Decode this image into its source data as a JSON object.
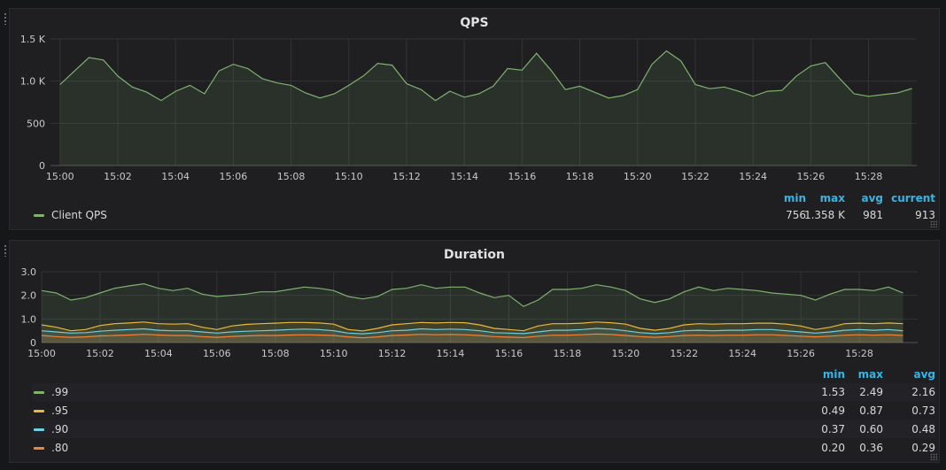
{
  "qps": {
    "title": "QPS",
    "y_ticks": [
      "0",
      "500",
      "1.0 K",
      "1.5 K"
    ],
    "x_ticks": [
      "15:00",
      "15:02",
      "15:04",
      "15:06",
      "15:08",
      "15:10",
      "15:12",
      "15:14",
      "15:16",
      "15:18",
      "15:20",
      "15:22",
      "15:24",
      "15:26",
      "15:28"
    ],
    "legend_headers": [
      "min",
      "max",
      "avg",
      "current"
    ],
    "legend": [
      {
        "name": "Client QPS",
        "color": "#7eb26d",
        "min": "756",
        "max": "1.358 K",
        "avg": "981",
        "current": "913"
      }
    ]
  },
  "duration": {
    "title": "Duration",
    "y_ticks": [
      "0",
      "1.0",
      "2.0",
      "3.0"
    ],
    "x_ticks": [
      "15:00",
      "15:02",
      "15:04",
      "15:06",
      "15:08",
      "15:10",
      "15:12",
      "15:14",
      "15:16",
      "15:18",
      "15:20",
      "15:22",
      "15:24",
      "15:26",
      "15:28"
    ],
    "legend_headers": [
      "min",
      "max",
      "avg"
    ],
    "legend": [
      {
        "name": ".99",
        "color": "#7eb26d",
        "min": "1.53",
        "max": "2.49",
        "avg": "2.16"
      },
      {
        "name": ".95",
        "color": "#eab839",
        "min": "0.49",
        "max": "0.87",
        "avg": "0.73"
      },
      {
        "name": ".90",
        "color": "#6ed0e0",
        "min": "0.37",
        "max": "0.60",
        "avg": "0.48"
      },
      {
        "name": ".80",
        "color": "#ef843c",
        "min": "0.20",
        "max": "0.36",
        "avg": "0.29"
      }
    ]
  },
  "chart_data": [
    {
      "type": "area",
      "title": "QPS",
      "ylim": [
        0,
        1500
      ],
      "xlim": [
        "14:59:40",
        "15:29:40"
      ],
      "grid": true,
      "legend_position": "bottom",
      "x_minutes": [
        0,
        0.5,
        1,
        1.5,
        2,
        2.5,
        3,
        3.5,
        4,
        4.5,
        5,
        5.5,
        6,
        6.5,
        7,
        7.5,
        8,
        8.5,
        9,
        9.5,
        10,
        10.5,
        11,
        11.5,
        12,
        12.5,
        13,
        13.5,
        14,
        14.5,
        15,
        15.5,
        16,
        16.5,
        17,
        17.5,
        18,
        18.5,
        19,
        19.5,
        20,
        20.5,
        21,
        21.5,
        22,
        22.5,
        23,
        23.5,
        24,
        24.5,
        25,
        25.5,
        26,
        26.5,
        27,
        27.5,
        28,
        28.5,
        29,
        29.5
      ],
      "series": [
        {
          "name": "Client QPS",
          "values": [
            960,
            1120,
            1280,
            1250,
            1060,
            930,
            870,
            770,
            880,
            950,
            850,
            1120,
            1200,
            1150,
            1030,
            980,
            950,
            860,
            800,
            850,
            950,
            1060,
            1210,
            1190,
            970,
            900,
            770,
            880,
            810,
            850,
            940,
            1150,
            1130,
            1330,
            1130,
            900,
            940,
            870,
            800,
            830,
            900,
            1200,
            1358,
            1240,
            960,
            910,
            930,
            880,
            820,
            880,
            890,
            1060,
            1180,
            1220,
            1030,
            850,
            820,
            840,
            860,
            913
          ]
        }
      ]
    },
    {
      "type": "area",
      "title": "Duration",
      "ylim": [
        0,
        3
      ],
      "xlim": [
        "15:00",
        "15:30"
      ],
      "grid": true,
      "legend_position": "bottom",
      "x_minutes": [
        0,
        0.5,
        1,
        1.5,
        2,
        2.5,
        3,
        3.5,
        4,
        4.5,
        5,
        5.5,
        6,
        6.5,
        7,
        7.5,
        8,
        8.5,
        9,
        9.5,
        10,
        10.5,
        11,
        11.5,
        12,
        12.5,
        13,
        13.5,
        14,
        14.5,
        15,
        15.5,
        16,
        16.5,
        17,
        17.5,
        18,
        18.5,
        19,
        19.5,
        20,
        20.5,
        21,
        21.5,
        22,
        22.5,
        23,
        23.5,
        24,
        24.5,
        25,
        25.5,
        26,
        26.5,
        27,
        27.5,
        28,
        28.5,
        29,
        29.5
      ],
      "series": [
        {
          "name": ".99",
          "values": [
            2.2,
            2.1,
            1.8,
            1.9,
            2.1,
            2.3,
            2.4,
            2.49,
            2.3,
            2.2,
            2.3,
            2.05,
            1.95,
            2.0,
            2.05,
            2.15,
            2.15,
            2.25,
            2.35,
            2.3,
            2.2,
            1.95,
            1.85,
            1.95,
            2.25,
            2.3,
            2.45,
            2.3,
            2.35,
            2.35,
            2.1,
            1.9,
            2.0,
            1.53,
            1.8,
            2.25,
            2.25,
            2.3,
            2.45,
            2.35,
            2.2,
            1.85,
            1.7,
            1.85,
            2.15,
            2.35,
            2.2,
            2.3,
            2.25,
            2.2,
            2.1,
            2.05,
            2.0,
            1.8,
            2.05,
            2.25,
            2.25,
            2.2,
            2.35,
            2.1
          ]
        },
        {
          "name": ".95",
          "values": [
            0.75,
            0.65,
            0.5,
            0.55,
            0.72,
            0.8,
            0.83,
            0.87,
            0.8,
            0.78,
            0.8,
            0.65,
            0.55,
            0.7,
            0.77,
            0.8,
            0.82,
            0.85,
            0.85,
            0.83,
            0.78,
            0.55,
            0.49,
            0.6,
            0.75,
            0.8,
            0.85,
            0.83,
            0.85,
            0.84,
            0.75,
            0.6,
            0.55,
            0.5,
            0.7,
            0.8,
            0.8,
            0.82,
            0.87,
            0.84,
            0.78,
            0.6,
            0.52,
            0.6,
            0.75,
            0.8,
            0.78,
            0.8,
            0.8,
            0.82,
            0.82,
            0.78,
            0.7,
            0.55,
            0.65,
            0.8,
            0.82,
            0.8,
            0.83,
            0.8
          ]
        },
        {
          "name": ".90",
          "values": [
            0.5,
            0.45,
            0.4,
            0.42,
            0.48,
            0.52,
            0.55,
            0.58,
            0.52,
            0.5,
            0.5,
            0.45,
            0.4,
            0.45,
            0.48,
            0.5,
            0.52,
            0.55,
            0.57,
            0.55,
            0.5,
            0.4,
            0.37,
            0.42,
            0.5,
            0.52,
            0.58,
            0.55,
            0.57,
            0.55,
            0.5,
            0.42,
            0.4,
            0.38,
            0.45,
            0.52,
            0.52,
            0.55,
            0.6,
            0.57,
            0.5,
            0.42,
            0.38,
            0.42,
            0.5,
            0.52,
            0.5,
            0.52,
            0.52,
            0.55,
            0.55,
            0.5,
            0.45,
            0.4,
            0.45,
            0.52,
            0.55,
            0.52,
            0.55,
            0.5
          ]
        },
        {
          "name": ".80",
          "values": [
            0.3,
            0.25,
            0.22,
            0.24,
            0.28,
            0.3,
            0.32,
            0.35,
            0.32,
            0.3,
            0.3,
            0.25,
            0.22,
            0.26,
            0.28,
            0.3,
            0.3,
            0.32,
            0.33,
            0.32,
            0.3,
            0.24,
            0.2,
            0.24,
            0.3,
            0.32,
            0.35,
            0.33,
            0.34,
            0.33,
            0.3,
            0.25,
            0.23,
            0.21,
            0.27,
            0.31,
            0.31,
            0.33,
            0.36,
            0.34,
            0.3,
            0.25,
            0.22,
            0.25,
            0.3,
            0.31,
            0.3,
            0.31,
            0.31,
            0.33,
            0.33,
            0.3,
            0.27,
            0.24,
            0.27,
            0.31,
            0.33,
            0.31,
            0.33,
            0.3
          ]
        }
      ]
    }
  ]
}
